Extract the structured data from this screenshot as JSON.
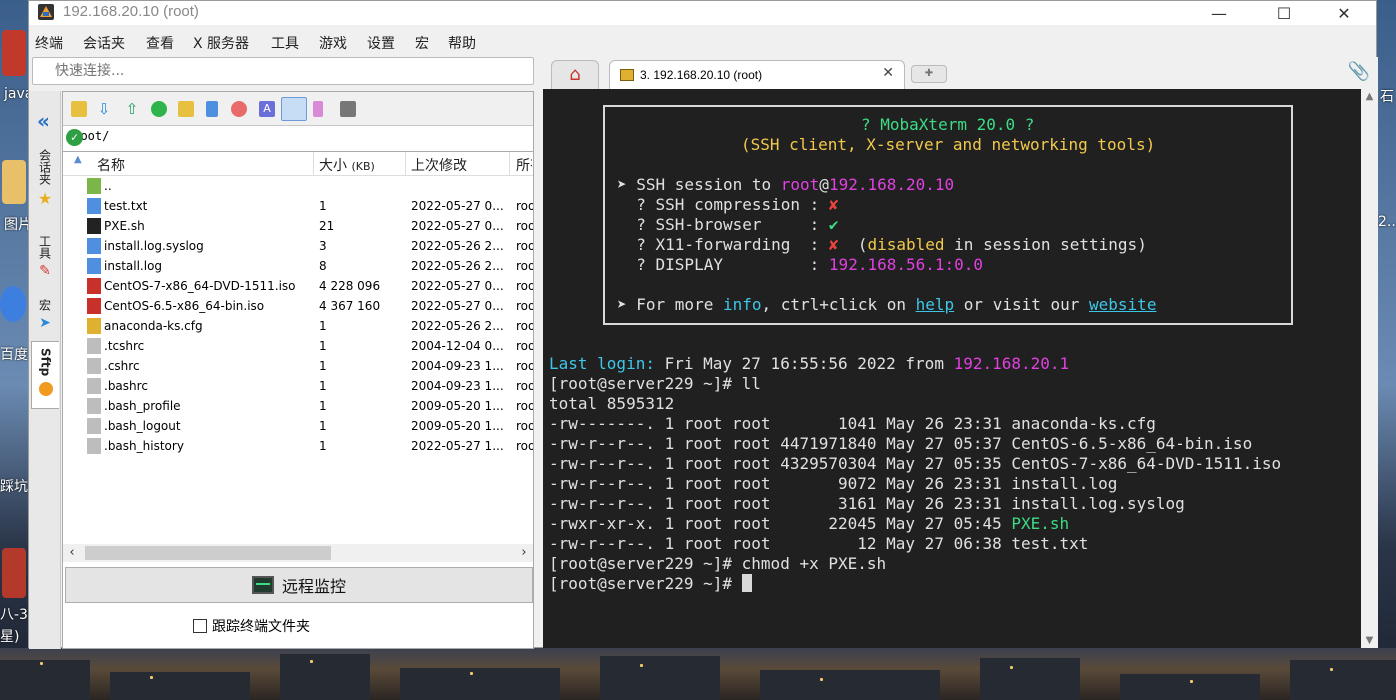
{
  "window": {
    "title": "192.168.20.10 (root)",
    "controls": {
      "minimize": "—",
      "maximize": "☐",
      "close": "✕"
    }
  },
  "menu": [
    "终端",
    "会话夹",
    "查看",
    "X 服务器",
    "工具",
    "游戏",
    "设置",
    "宏",
    "帮助"
  ],
  "quick_connect": {
    "placeholder": "快速连接..."
  },
  "side_tabs": {
    "sessions": "会话夹",
    "tools": "工具",
    "macros": "宏",
    "sftp": "Sftp"
  },
  "sftp": {
    "path": "/root/",
    "columns": {
      "name": "名称",
      "size": "大小",
      "size_unit": "(KB)",
      "modified": "上次修改",
      "owner": "所有"
    },
    "files": [
      {
        "name": "..",
        "size": "",
        "modified": "",
        "owner": "",
        "icon": "folder-up-icon"
      },
      {
        "name": "test.txt",
        "size": "1",
        "modified": "2022-05-27 0...",
        "owner": "roo",
        "icon": "text-file-icon"
      },
      {
        "name": "PXE.sh",
        "size": "21",
        "modified": "2022-05-27 0...",
        "owner": "roo",
        "icon": "shell-script-icon"
      },
      {
        "name": "install.log.syslog",
        "size": "3",
        "modified": "2022-05-26 2...",
        "owner": "roo",
        "icon": "text-file-icon"
      },
      {
        "name": "install.log",
        "size": "8",
        "modified": "2022-05-26 2...",
        "owner": "roo",
        "icon": "text-file-icon"
      },
      {
        "name": "CentOS-7-x86_64-DVD-1511.iso",
        "size": "4 228 096",
        "modified": "2022-05-27 0...",
        "owner": "roo",
        "icon": "iso-file-icon"
      },
      {
        "name": "CentOS-6.5-x86_64-bin.iso",
        "size": "4 367 160",
        "modified": "2022-05-27 0...",
        "owner": "roo",
        "icon": "iso-file-icon"
      },
      {
        "name": "anaconda-ks.cfg",
        "size": "1",
        "modified": "2022-05-26 2...",
        "owner": "roo",
        "icon": "config-file-icon"
      },
      {
        "name": ".tcshrc",
        "size": "1",
        "modified": "2004-12-04 0...",
        "owner": "roo",
        "icon": "file-icon"
      },
      {
        "name": ".cshrc",
        "size": "1",
        "modified": "2004-09-23 1...",
        "owner": "roo",
        "icon": "file-icon"
      },
      {
        "name": ".bashrc",
        "size": "1",
        "modified": "2004-09-23 1...",
        "owner": "roo",
        "icon": "file-icon"
      },
      {
        "name": ".bash_profile",
        "size": "1",
        "modified": "2009-05-20 1...",
        "owner": "roo",
        "icon": "file-icon"
      },
      {
        "name": ".bash_logout",
        "size": "1",
        "modified": "2009-05-20 1...",
        "owner": "roo",
        "icon": "file-icon"
      },
      {
        "name": ".bash_history",
        "size": "1",
        "modified": "2022-05-27 1...",
        "owner": "roo",
        "icon": "file-icon"
      }
    ],
    "remote_monitor": "远程监控",
    "follow_terminal": "跟踪终端文件夹"
  },
  "tabs": {
    "session_tab": "3. 192.168.20.10 (root)"
  },
  "terminal": {
    "banner": [
      {
        "parts": [
          {
            "t": "? MobaXterm 20.0 ?",
            "c": "g"
          }
        ]
      },
      {
        "parts": [
          {
            "t": "(SSH client, X-server and networking tools)",
            "c": "y"
          }
        ]
      },
      {
        "parts": [
          {
            "t": "",
            "c": ""
          }
        ]
      },
      {
        "parts": [
          {
            "t": "➤ SSH session to ",
            "c": ""
          },
          {
            "t": "root",
            "c": "m"
          },
          {
            "t": "@",
            "c": ""
          },
          {
            "t": "192.168.20.10",
            "c": "m"
          }
        ]
      },
      {
        "parts": [
          {
            "t": "  ? SSH compression : ",
            "c": ""
          },
          {
            "t": "✘",
            "c": "r"
          }
        ]
      },
      {
        "parts": [
          {
            "t": "  ? SSH-browser     : ",
            "c": ""
          },
          {
            "t": "✔",
            "c": "g"
          }
        ]
      },
      {
        "parts": [
          {
            "t": "  ? X11-forwarding  : ",
            "c": ""
          },
          {
            "t": "✘",
            "c": "r"
          },
          {
            "t": "  (",
            "c": ""
          },
          {
            "t": "disabled",
            "c": "y"
          },
          {
            "t": " in session settings)",
            "c": ""
          }
        ]
      },
      {
        "parts": [
          {
            "t": "  ? DISPLAY         : ",
            "c": ""
          },
          {
            "t": "192.168.56.1:0.0",
            "c": "m"
          }
        ]
      },
      {
        "parts": [
          {
            "t": "",
            "c": ""
          }
        ]
      },
      {
        "parts": [
          {
            "t": "➤ For more ",
            "c": ""
          },
          {
            "t": "info",
            "c": "c"
          },
          {
            "t": ", ctrl+click on ",
            "c": ""
          },
          {
            "t": "help",
            "c": "u"
          },
          {
            "t": " or visit our ",
            "c": ""
          },
          {
            "t": "website",
            "c": "u"
          }
        ]
      }
    ],
    "lines": [
      {
        "parts": [
          {
            "t": "Last login: ",
            "c": "c"
          },
          {
            "t": "Fri May 27 16:55:56 2022 from ",
            "c": ""
          },
          {
            "t": "192.168.20.1",
            "c": "m"
          }
        ]
      },
      {
        "parts": [
          {
            "t": "[root@server229 ~]# ll",
            "c": ""
          }
        ]
      },
      {
        "parts": [
          {
            "t": "total 8595312",
            "c": ""
          }
        ]
      },
      {
        "parts": [
          {
            "t": "-rw-------. 1 root root       1041 May 26 23:31 anaconda-ks.cfg",
            "c": ""
          }
        ]
      },
      {
        "parts": [
          {
            "t": "-rw-r--r--. 1 root root 4471971840 May 27 05:37 CentOS-6.5-x86_64-bin.iso",
            "c": ""
          }
        ]
      },
      {
        "parts": [
          {
            "t": "-rw-r--r--. 1 root root 4329570304 May 27 05:35 CentOS-7-x86_64-DVD-1511.iso",
            "c": ""
          }
        ]
      },
      {
        "parts": [
          {
            "t": "-rw-r--r--. 1 root root       9072 May 26 23:31 install.log",
            "c": ""
          }
        ]
      },
      {
        "parts": [
          {
            "t": "-rw-r--r--. 1 root root       3161 May 26 23:31 install.log.syslog",
            "c": ""
          }
        ]
      },
      {
        "parts": [
          {
            "t": "-rwxr-xr-x. 1 root root      22045 May 27 05:45 ",
            "c": ""
          },
          {
            "t": "PXE.sh",
            "c": "g"
          }
        ]
      },
      {
        "parts": [
          {
            "t": "-rw-r--r--. 1 root root         12 May 27 06:38 test.txt",
            "c": ""
          }
        ]
      },
      {
        "parts": [
          {
            "t": "[root@server229 ~]# chmod +x PXE.sh",
            "c": ""
          }
        ]
      },
      {
        "parts": [
          {
            "t": "[root@server229 ~]# ",
            "c": ""
          }
        ]
      }
    ]
  },
  "desktop": {
    "labels": [
      "java",
      "图片",
      "百度网",
      "踩坑_",
      "八-3",
      "星)",
      "2...",
      "石"
    ]
  }
}
